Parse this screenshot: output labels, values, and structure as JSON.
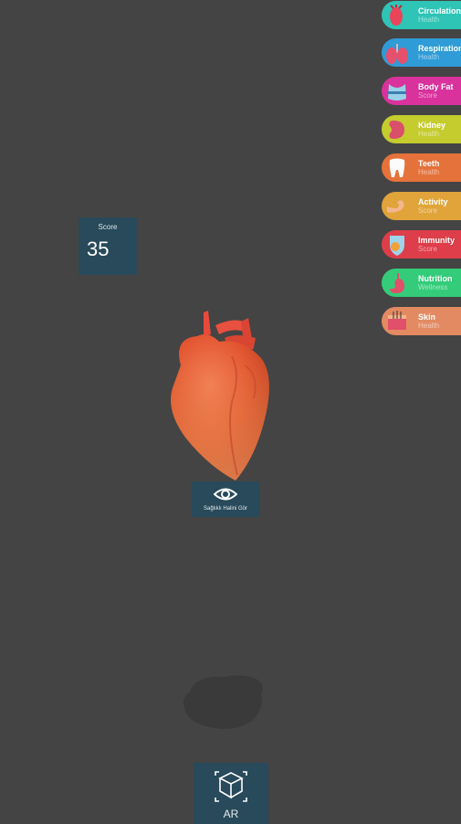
{
  "menu": [
    {
      "line1": "Circulation",
      "line2": "Health",
      "color": "#2ec4b6",
      "icon": "veins-icon"
    },
    {
      "line1": "Respiration",
      "line2": "Health",
      "color": "#2f9bd7",
      "icon": "lungs-icon"
    },
    {
      "line1": "Body Fat",
      "line2": "Score",
      "color": "#d9329c",
      "icon": "waist-icon"
    },
    {
      "line1": "Kidney",
      "line2": "Health",
      "color": "#c4cc2e",
      "icon": "kidney-icon"
    },
    {
      "line1": "Teeth",
      "line2": "Health",
      "color": "#e5723a",
      "icon": "tooth-icon"
    },
    {
      "line1": "Activity",
      "line2": "Score",
      "color": "#e0a43a",
      "icon": "arm-muscle-icon"
    },
    {
      "line1": "Immunity",
      "line2": "Score",
      "color": "#dd3e4a",
      "icon": "virus-shield-icon"
    },
    {
      "line1": "Nutrition",
      "line2": "Wellness",
      "color": "#34cc7a",
      "icon": "stomach-icon"
    },
    {
      "line1": "Skin",
      "line2": "Health",
      "color": "#e38a62",
      "icon": "skin-icon"
    }
  ],
  "score": {
    "label": "Score",
    "value": "35"
  },
  "view_button": {
    "label": "Sağlıklı Halini Gör",
    "icon": "eye-icon"
  },
  "ar_button": {
    "label": "AR",
    "icon": "ar-cube-icon"
  }
}
